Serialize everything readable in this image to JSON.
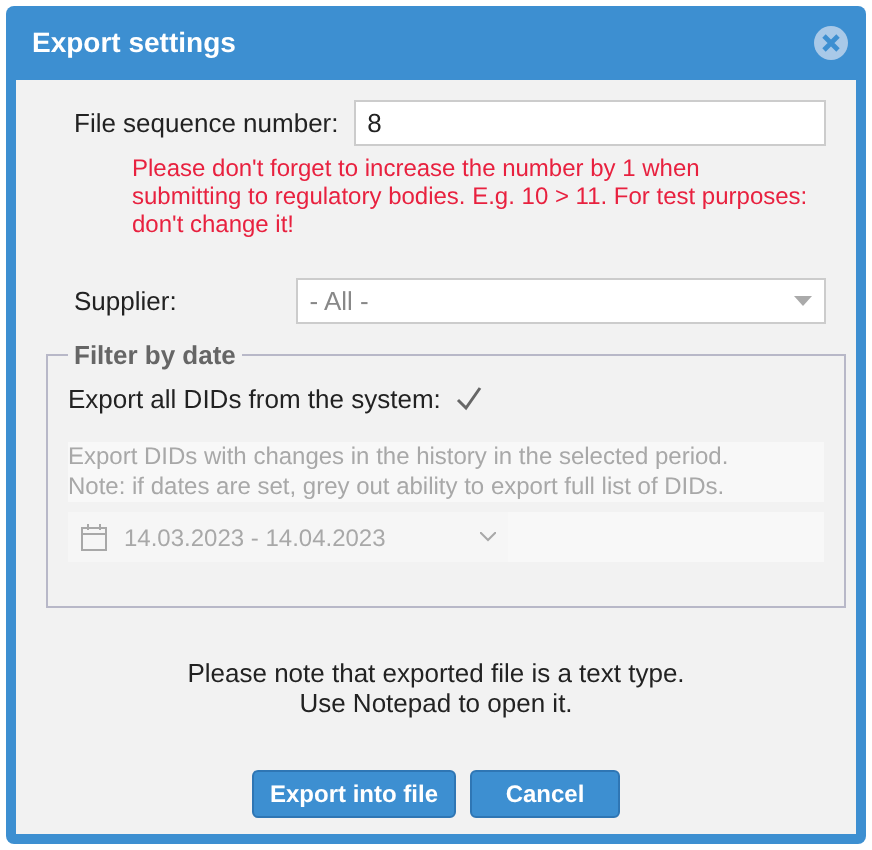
{
  "dialog": {
    "title": "Export settings"
  },
  "sequence": {
    "label": "File sequence number:",
    "value": "8",
    "warning": "Please don't forget to increase the number by 1 when submitting to regulatory bodies. E.g. 10 > 11. For test purposes: don't change it!"
  },
  "supplier": {
    "label": "Supplier:",
    "value": "- All -"
  },
  "filter": {
    "legend": "Filter by date",
    "export_all": {
      "label": "Export all DIDs from the system:",
      "checked": true
    },
    "period": {
      "disabled": true,
      "note": [
        "Export DIDs with changes in the history in the selected period.",
        "Note: if dates are set, grey out ability to export full list of DIDs."
      ],
      "range": "14.03.2023 - 14.04.2023"
    }
  },
  "note": [
    "Please note that exported file is a text type.",
    "Use Notepad to open it."
  ],
  "buttons": [
    "Export into file",
    "Cancel"
  ]
}
